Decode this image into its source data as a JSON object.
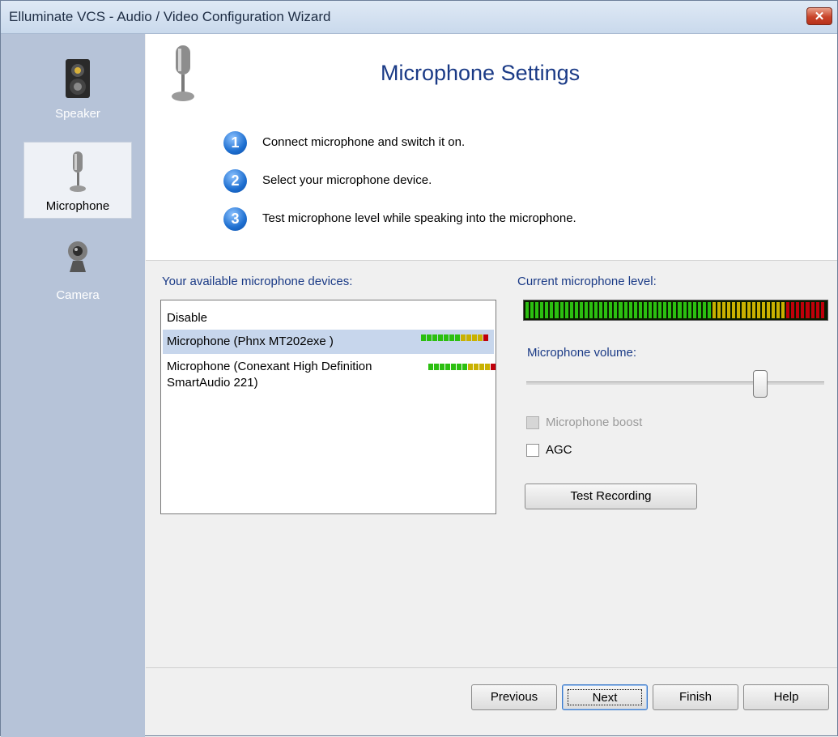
{
  "window": {
    "title": "Elluminate VCS - Audio / Video Configuration Wizard",
    "close_glyph": "✕"
  },
  "sidebar": {
    "items": [
      {
        "label": "Speaker",
        "icon": "speaker-icon"
      },
      {
        "label": "Microphone",
        "icon": "microphone-icon",
        "active": true
      },
      {
        "label": "Camera",
        "icon": "webcam-icon"
      }
    ]
  },
  "header": {
    "title": "Microphone Settings",
    "steps": [
      {
        "num": "1",
        "text": "Connect microphone and switch it on."
      },
      {
        "num": "2",
        "text": "Select your microphone device."
      },
      {
        "num": "3",
        "text": "Test microphone level while speaking into the microphone."
      }
    ]
  },
  "devices": {
    "label": "Your available microphone devices:",
    "items": [
      {
        "name": "Disable"
      },
      {
        "name": "Microphone (Phnx MT202exe )",
        "selected": true
      },
      {
        "name": "Microphone (Conexant High Definition SmartAudio 221)"
      }
    ]
  },
  "level": {
    "label": "Current microphone level:",
    "colors": {
      "green": "#2bbf10",
      "yellow": "#c9b100",
      "red": "#c0000a"
    }
  },
  "volume": {
    "label": "Microphone volume:",
    "value_fraction": 0.78
  },
  "boost": {
    "label": "Microphone boost",
    "checked": false,
    "disabled": true
  },
  "agc": {
    "label": "AGC",
    "checked": false
  },
  "test_button": "Test Recording",
  "nav": {
    "previous": "Previous",
    "next": "Next",
    "finish": "Finish",
    "help": "Help"
  }
}
